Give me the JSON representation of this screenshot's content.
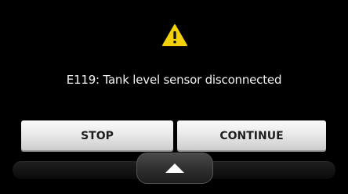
{
  "dialog": {
    "icon": "warning-icon",
    "message": "E119: Tank level sensor disconnected"
  },
  "buttons": {
    "stop_label": "STOP",
    "continue_label": "CONTINUE"
  },
  "bottom_bar": {
    "expand_icon": "up-arrow-icon"
  },
  "colors": {
    "warning_yellow": "#f4d10a",
    "background": "#000000",
    "button_face": "#e6e6e6"
  }
}
